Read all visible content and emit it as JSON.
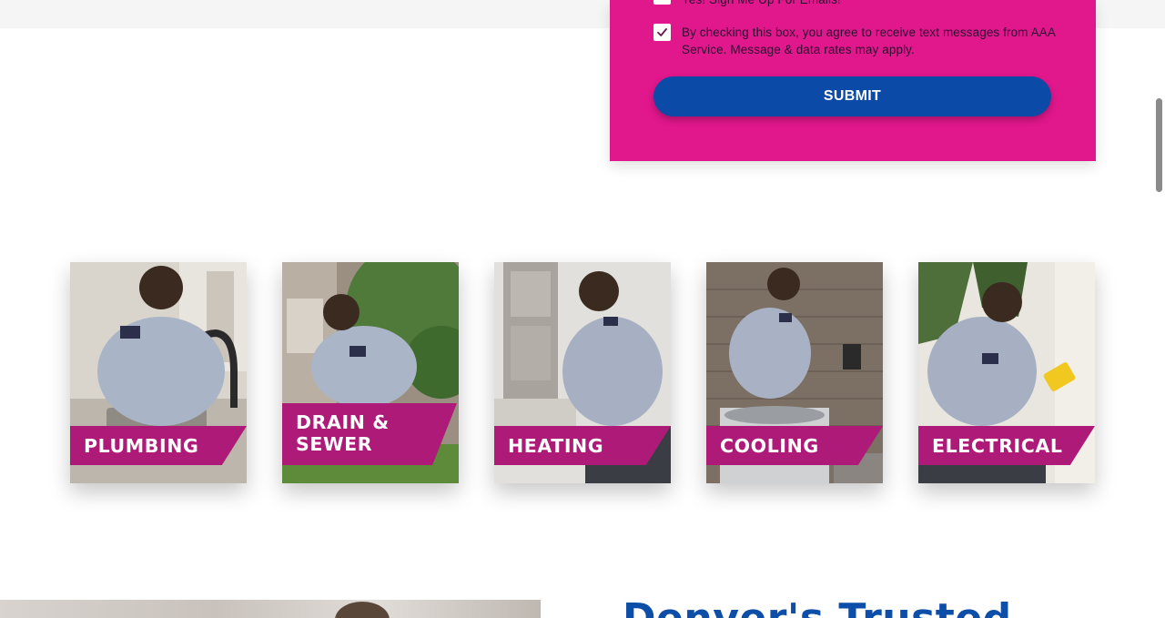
{
  "form": {
    "email_checkbox_label": "Yes! Sign Me Up For Emails!",
    "sms_checkbox_label": "By checking this box, you agree to receive text messages from AAA Service. Message & data rates may apply.",
    "submit_label": "SUBMIT"
  },
  "services": [
    {
      "line1": "PLUMBING"
    },
    {
      "line1": "DRAIN &",
      "line2": "SEWER"
    },
    {
      "line1": "HEATING"
    },
    {
      "line1": "COOLING"
    },
    {
      "line1": "ELECTRICAL"
    }
  ],
  "bottom": {
    "heading": "Denver's Trusted"
  },
  "colors": {
    "form_bg": "#e1178c",
    "submit_bg": "#0b4aa6",
    "banner_bg": "#ad1a78",
    "heading": "#0d4ea8"
  },
  "icons": {
    "checkbox_mark": "checkmark-icon"
  }
}
